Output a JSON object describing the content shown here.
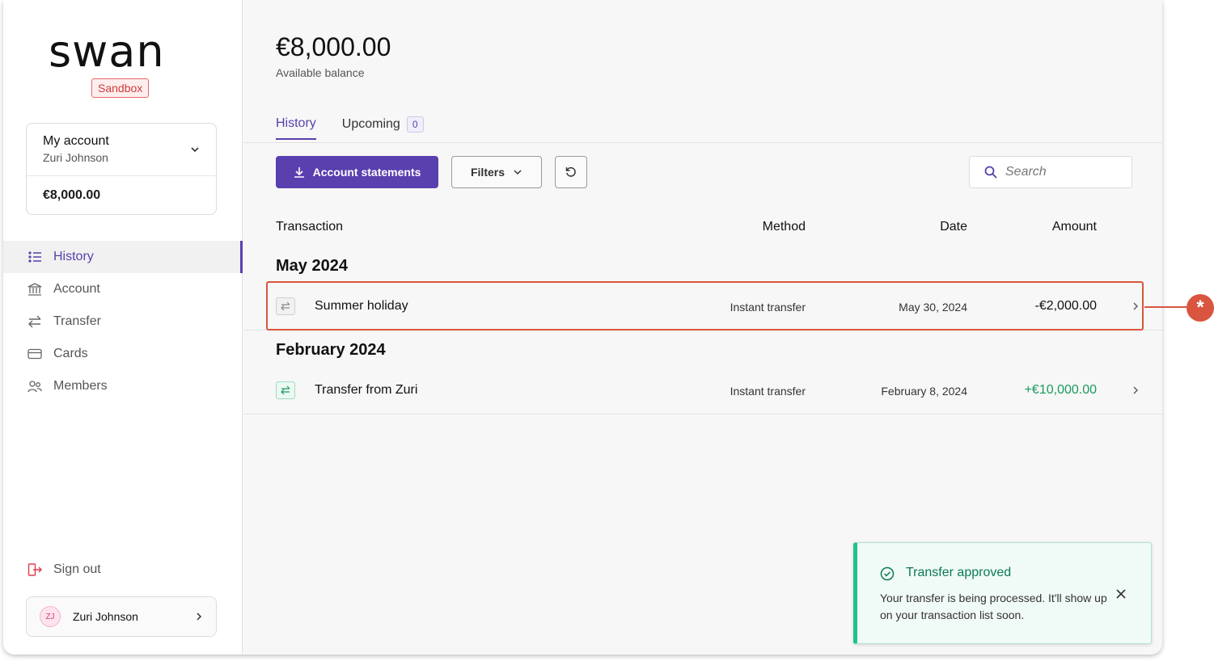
{
  "brand": {
    "logo_text": "swan",
    "env_badge": "Sandbox"
  },
  "account_card": {
    "name": "My account",
    "holder": "Zuri Johnson",
    "balance": "€8,000.00"
  },
  "nav": {
    "items": [
      {
        "label": "History",
        "icon": "list-icon",
        "active": true
      },
      {
        "label": "Account",
        "icon": "bank-icon",
        "active": false
      },
      {
        "label": "Transfer",
        "icon": "transfer-icon",
        "active": false
      },
      {
        "label": "Cards",
        "icon": "card-icon",
        "active": false
      },
      {
        "label": "Members",
        "icon": "members-icon",
        "active": false
      }
    ],
    "sign_out": "Sign out"
  },
  "user": {
    "initials": "ZJ",
    "name": "Zuri Johnson"
  },
  "header": {
    "balance": "€8,000.00",
    "balance_label": "Available balance"
  },
  "tabs": {
    "history": "History",
    "upcoming": "Upcoming",
    "upcoming_count": "0"
  },
  "toolbar": {
    "statements": "Account statements",
    "filters": "Filters",
    "search_placeholder": "Search"
  },
  "table": {
    "headers": {
      "transaction": "Transaction",
      "method": "Method",
      "date": "Date",
      "amount": "Amount"
    },
    "groups": [
      {
        "title": "May 2024",
        "rows": [
          {
            "label": "Summer holiday",
            "method": "Instant transfer",
            "date": "May 30, 2024",
            "amount": "-€2,000.00"
          }
        ]
      },
      {
        "title": "February 2024",
        "rows": [
          {
            "label": "Transfer from Zuri",
            "method": "Instant transfer",
            "date": "February 8, 2024",
            "amount": "+€10,000.00"
          }
        ]
      }
    ]
  },
  "toast": {
    "title": "Transfer approved",
    "message": "Your transfer is being processed. It'll show up on your transaction list soon."
  },
  "callout": {
    "symbol": "*"
  },
  "colors": {
    "accent": "#5a3fae",
    "positive": "#1a9a5c",
    "success_border": "#1ec38b",
    "highlight": "#d9553f",
    "sandbox": "#d23b3b"
  }
}
